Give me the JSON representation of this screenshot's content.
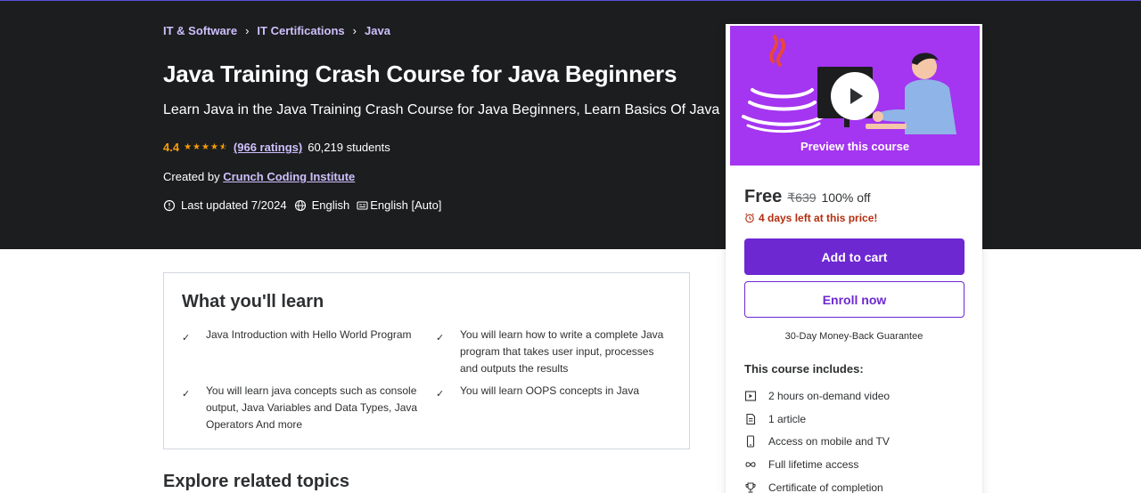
{
  "breadcrumb": [
    {
      "label": "IT & Software"
    },
    {
      "label": "IT Certifications"
    },
    {
      "label": "Java"
    }
  ],
  "breadcrumb_separator": "›",
  "course": {
    "title": "Java Training Crash Course for Java Beginners",
    "subtitle": "Learn Java in the Java Training Crash Course for Java Beginners, Learn Basics Of Java",
    "rating": "4.4",
    "stars_filled": 4.5,
    "ratings_count": "(966 ratings)",
    "students": "60,219 students",
    "created_by_prefix": "Created by",
    "instructor": "Crunch Coding Institute",
    "last_updated": "Last updated 7/2024",
    "language": "English",
    "captions": "English [Auto]"
  },
  "card": {
    "preview_label": "Preview this course",
    "price": "Free",
    "original_price": "₹639",
    "discount": "100% off",
    "timer": "4 days left at this price!",
    "add_to_cart": "Add to cart",
    "enroll_now": "Enroll now",
    "guarantee": "30-Day Money-Back Guarantee",
    "includes_title": "This course includes:",
    "includes": [
      {
        "icon": "video-icon",
        "label": "2 hours on-demand video"
      },
      {
        "icon": "article-icon",
        "label": "1 article"
      },
      {
        "icon": "mobile-icon",
        "label": "Access on mobile and TV"
      },
      {
        "icon": "infinity-icon",
        "label": "Full lifetime access"
      },
      {
        "icon": "trophy-icon",
        "label": "Certificate of completion"
      }
    ]
  },
  "learn": {
    "title": "What you'll learn",
    "items": [
      "Java Introduction with Hello World Program",
      "You will learn how to write a complete Java program that takes user input, processes and outputs the results",
      "You will learn java concepts such as console output, Java Variables and Data Types, Java Operators And more",
      "You will learn OOPS concepts in Java"
    ]
  },
  "explore_title": "Explore related topics",
  "colors": {
    "hero_bg": "#1c1d1f",
    "accent": "#6d28d2",
    "link": "#cec0fc",
    "star": "#f69c08",
    "timer": "#b32d0f",
    "preview_bg": "#a435f0"
  }
}
